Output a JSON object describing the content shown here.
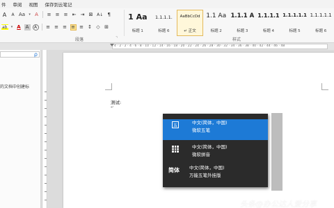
{
  "menu": {
    "items": [
      {
        "label": "件"
      },
      {
        "label": "审阅"
      },
      {
        "label": "视图"
      },
      {
        "label": "保存到云笔记"
      }
    ]
  },
  "ribbon": {
    "font_size_up": "A",
    "font_size_down": "A",
    "change_case": "Aa",
    "clear_format": "A",
    "bullets": "≡",
    "numbering": "≡",
    "multilevel": "≡",
    "decrease_indent": "⇤",
    "increase_indent": "⇥",
    "chinese_layout": "⊠",
    "sort": "A↓",
    "show_marks": "¶",
    "highlight": "ab",
    "font_color": "A",
    "char_shading": "A",
    "enclose": "A",
    "align_left": "≡",
    "align_center": "≡",
    "align_right": "≡",
    "justify": "≡",
    "distribute": "≡",
    "line_spacing": "↕",
    "shading": "◇",
    "borders": "⊞",
    "paragraph_group_label": "段落",
    "styles_group_label": "样式"
  },
  "styles_gallery": [
    {
      "preview": "1 Aa",
      "name": "标题 1"
    },
    {
      "preview": "1.1.1.1.",
      "name": "标题 6"
    },
    {
      "preview": "AaBbCcDd",
      "name": "↵ 正文"
    },
    {
      "preview": "1.1 Aa",
      "name": "标题 2"
    },
    {
      "preview": "1.1.1 A",
      "name": "标题 3"
    },
    {
      "preview": "1.1.1.1",
      "name": "标题 4"
    },
    {
      "preview": "1.1.1.1.1",
      "name": "标题 5"
    },
    {
      "preview": "1.1.1.1.1",
      "name": "标题 6"
    }
  ],
  "ruler": {
    "ticks": "4 · 2 · 2 · 4 · 6 · 8 · 10 · 12 · 14 · 16 · 18 · 20 · 22 · 24 · 26 · 28 · 30 · 32 · 34 · 36 · 38 · 40 · 42 · 44 · 46 · 48"
  },
  "nav_pane": {
    "hint_text": "的文档中创建标",
    "search_icon": "ρ"
  },
  "document": {
    "body_text": "测试:",
    "paragraph_mark": "↵"
  },
  "ime_popup": {
    "items": [
      {
        "icon_text": "五",
        "line1": "中文(简体，中国)",
        "line2": "微软五笔",
        "active": true
      },
      {
        "icon_text": "",
        "line1": "中文(简体，中国)",
        "line2": "微软拼音",
        "active": false
      },
      {
        "icon_text": "简体",
        "line1": "中文(简体，中国)",
        "line2": "万能五笔外挂版",
        "active": false
      }
    ]
  },
  "watermark": "头条@办公达人爱分享"
}
